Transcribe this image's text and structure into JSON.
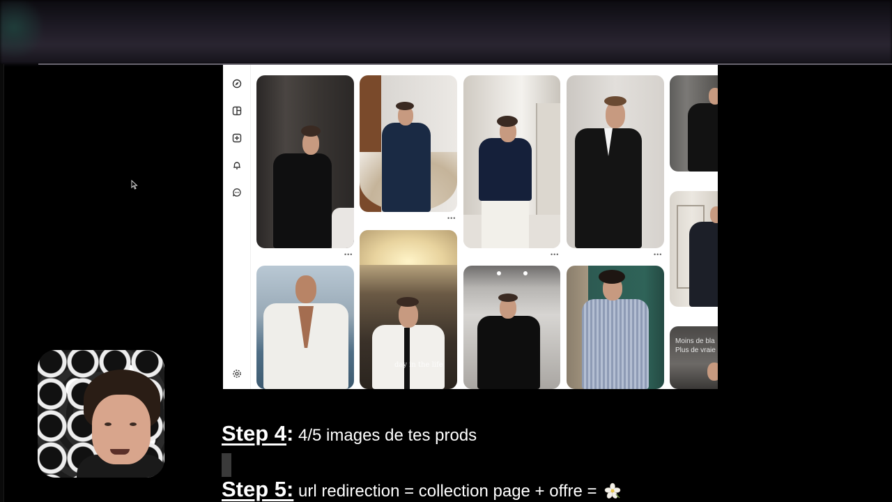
{
  "pin_overlays": {
    "day_in_life": "day in the life",
    "moins_de_bla": "Moins de bla",
    "plus_de_vrai": "Plus de vraie"
  },
  "pin_dots": "•••",
  "steps": {
    "step4": {
      "label": "Step 4",
      "colon": ":",
      "text": " 4/5 images de tes prods"
    },
    "step5": {
      "label": "Step 5:",
      "text": " url redirection = collection page + offre ="
    }
  },
  "icons": [
    "compass-icon",
    "board-icon",
    "create-plus-icon",
    "bell-icon",
    "chat-icon",
    "settings-gear-icon",
    "flower-emoji-icon"
  ],
  "colors": {
    "background": "#000000",
    "pinterest_bg": "#ffffff",
    "text": "#ffffff"
  }
}
